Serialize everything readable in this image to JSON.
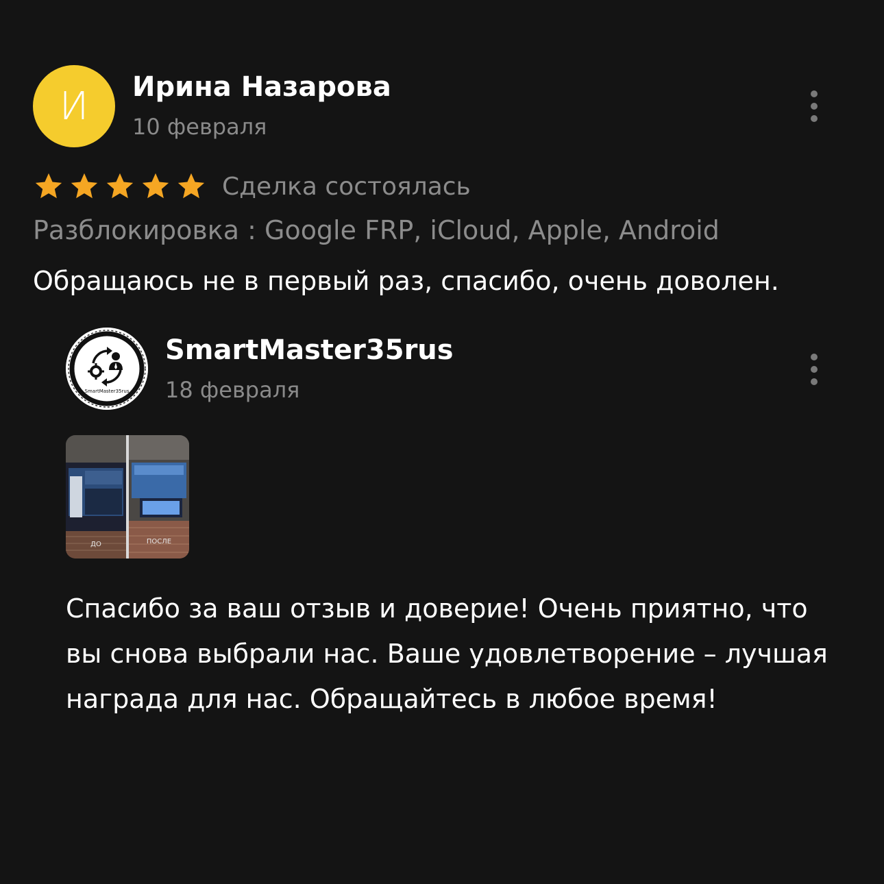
{
  "review": {
    "author": {
      "initial": "И",
      "avatar_color": "#f5cc2d",
      "name": "Ирина Назарова",
      "date": "10 февраля"
    },
    "rating": {
      "stars": 5,
      "max_stars": 5,
      "star_color": "#f5a623",
      "status": "Сделка состоялась"
    },
    "category": "Разблокировка : Google FRP, iCloud, Apple, Android",
    "text": "Обращаюсь не в первый раз, спасибо, очень доволен.",
    "more_icon": "more-vertical-icon"
  },
  "reply": {
    "seller": {
      "name": "SmartMaster35rus",
      "date": "18 февраля",
      "logo_caption": "SmartMaster35rus"
    },
    "attachment": {
      "labels": [
        "ДО",
        "ПОСЛЕ"
      ]
    },
    "text": "Спасибо за ваш отзыв и доверие! Очень приятно, что вы снова выбрали нас. Ваше удовлетворение – лучшая награда для нас. Обращайтесь в любое время!",
    "more_icon": "more-vertical-icon"
  }
}
